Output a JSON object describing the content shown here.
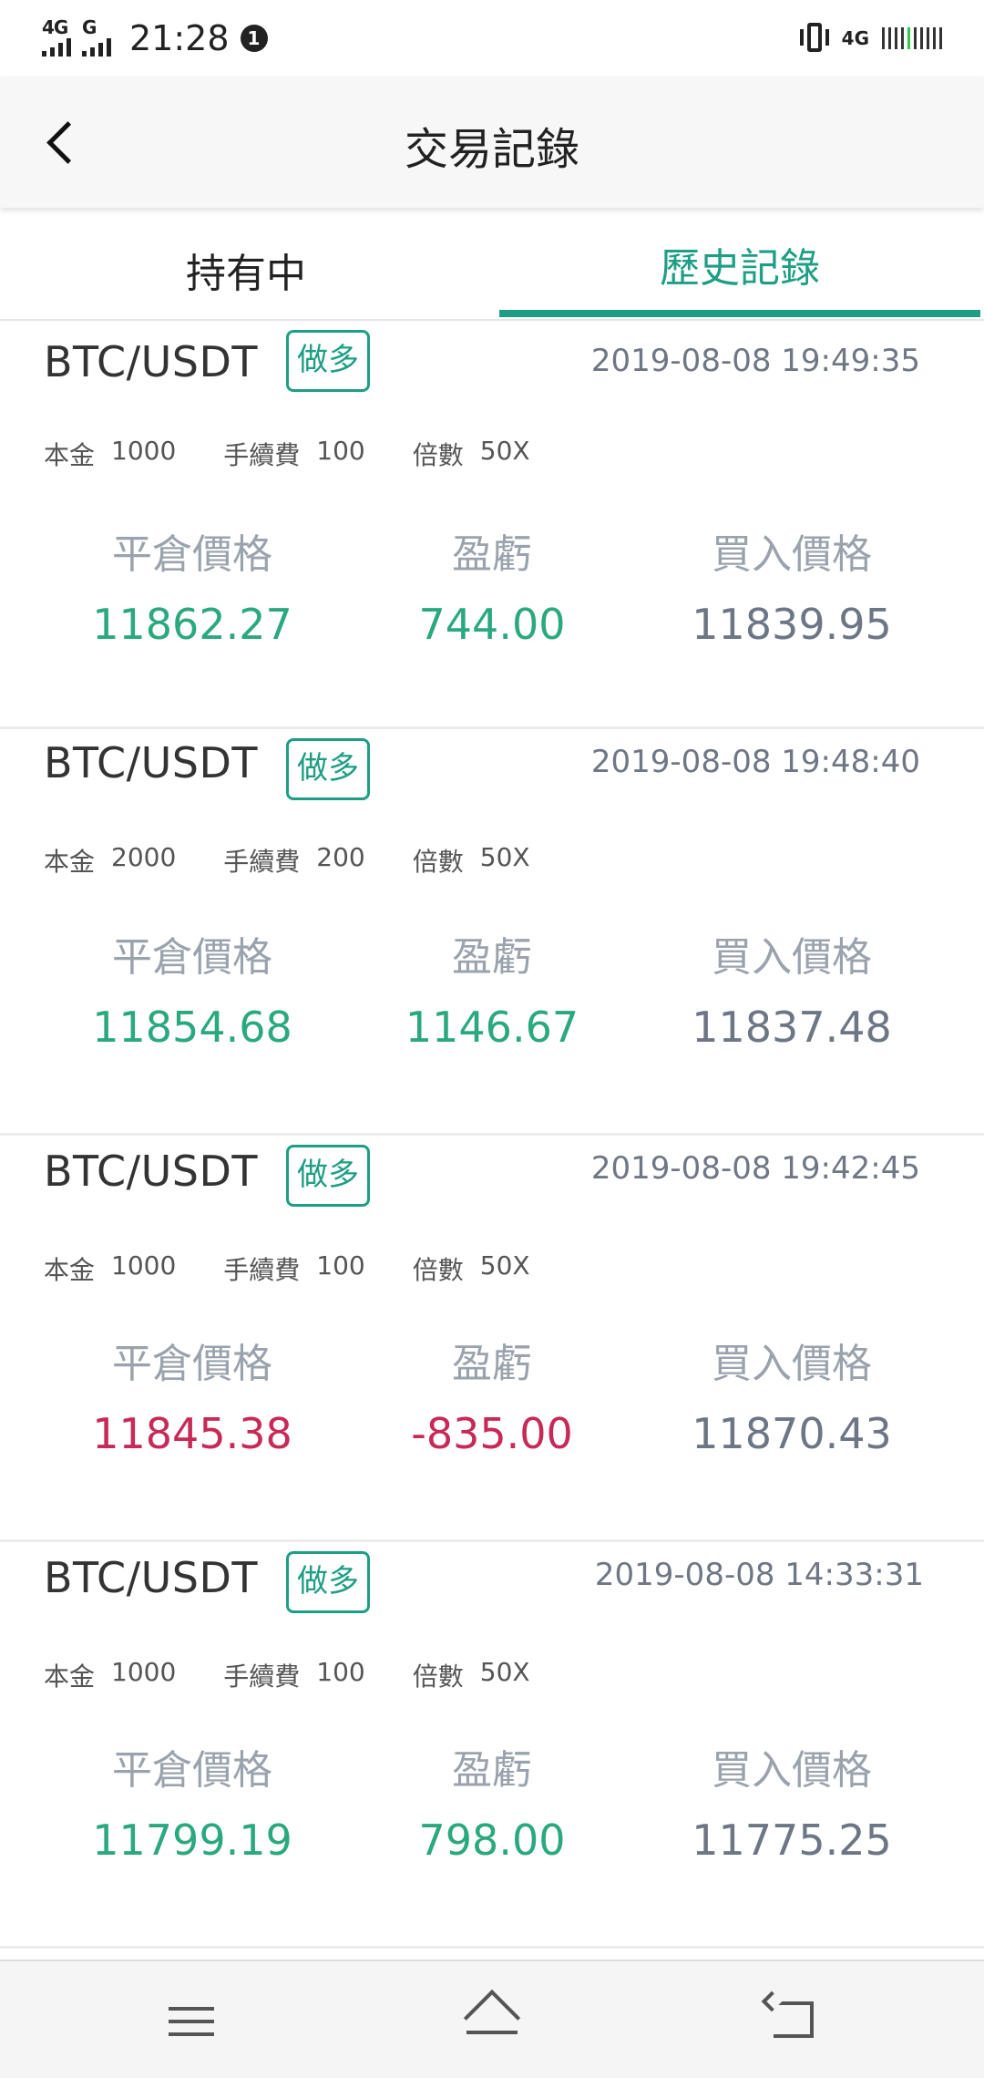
{
  "status_bar": {
    "sig1_label": "4G",
    "sig2_label": "G",
    "time": "21:28",
    "notif_badge": "1",
    "net_right": "4G"
  },
  "header": {
    "title": "交易記錄"
  },
  "tabs": [
    {
      "label": "持有中",
      "active": false
    },
    {
      "label": "歷史記錄",
      "active": true
    }
  ],
  "labels": {
    "principal": "本金",
    "fee": "手續費",
    "leverage": "倍數",
    "close_price": "平倉價格",
    "pnl": "盈虧",
    "buy_price": "買入價格"
  },
  "records": [
    {
      "pair": "BTC/USDT",
      "direction": "做多",
      "time": "2019-08-08 19:49:35",
      "principal": "1000",
      "fee": "100",
      "leverage": "50X",
      "close_price": "11862.27",
      "pnl": "744.00",
      "buy_price": "11839.95",
      "trend": "pos"
    },
    {
      "pair": "BTC/USDT",
      "direction": "做多",
      "time": "2019-08-08 19:48:40",
      "principal": "2000",
      "fee": "200",
      "leverage": "50X",
      "close_price": "11854.68",
      "pnl": "1146.67",
      "buy_price": "11837.48",
      "trend": "pos"
    },
    {
      "pair": "BTC/USDT",
      "direction": "做多",
      "time": "2019-08-08 19:42:45",
      "principal": "1000",
      "fee": "100",
      "leverage": "50X",
      "close_price": "11845.38",
      "pnl": "-835.00",
      "buy_price": "11870.43",
      "trend": "neg"
    },
    {
      "pair": "BTC/USDT",
      "direction": "做多",
      "time": "2019-08-08 14:33:31",
      "principal": "1000",
      "fee": "100",
      "leverage": "50X",
      "close_price": "11799.19",
      "pnl": "798.00",
      "buy_price": "11775.25",
      "trend": "pos"
    }
  ],
  "colors": {
    "accent": "#1e9e85",
    "profit": "#2aa87e",
    "loss": "#c72a57",
    "neutral": "#6d7685"
  },
  "icons": {
    "back": "chevron-left-icon",
    "nav_menu": "menu-icon",
    "nav_home": "home-icon",
    "nav_back": "back-icon"
  }
}
